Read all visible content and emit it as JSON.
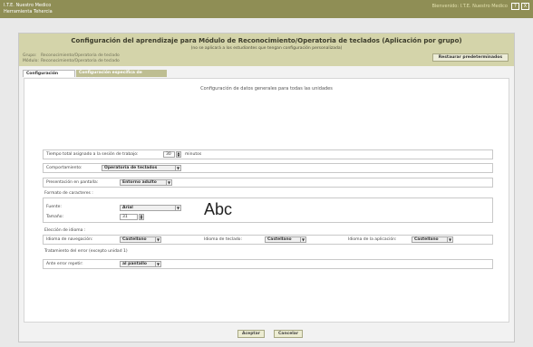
{
  "window": {
    "app_title": "I.T.E. Nuestro Medico",
    "app_subtitle": "Herramienta Tehercia",
    "user": "Bienvenido: I.T.E. Nuestro Medico",
    "help_label": "?",
    "close_label": "X"
  },
  "dialog": {
    "title": "Configuración del aprendizaje para Módulo de Reconocimiento/Operatoria de teclados (Aplicación por grupo)",
    "subtitle": "(no se aplicará a los estudiantes que tengan configuración personalizada)",
    "group_label": "Grupo:",
    "group_value": "Reconocimiento/Operatoria de teclado",
    "module_label": "Módulo:",
    "module_value": "Reconocimiento/Operatoria de teclado",
    "restore_label": "Restaurar predeterminados"
  },
  "tabs": [
    {
      "label": "Configuración general",
      "active": true
    },
    {
      "label": "Configuración específica de unidades",
      "active": false
    }
  ],
  "panel": {
    "heading": "Configuración de datos generales para todas las unidades",
    "time": {
      "label": "Tiempo total asignado a la sesión de trabajo:",
      "value": "30",
      "unit": "minutos"
    },
    "behavior": {
      "label": "Comportamiento:",
      "value": "Operatoria de teclados"
    },
    "presentation": {
      "label": "Presentación en pantalla:",
      "value": "Entorno adulto"
    },
    "char_format": {
      "section": "Formato de caracteres :",
      "font_label": "Fuente:",
      "font_value": "Arial",
      "size_label": "Tamaño:",
      "size_value": "31",
      "preview": "Abc"
    },
    "language": {
      "section": "Elección de idioma :",
      "nav_label": "Idioma de navegación:",
      "nav_value": "Castellano",
      "kbd_label": "Idioma de teclado:",
      "kbd_value": "Castellano",
      "app_label": "Idioma de la aplicación:",
      "app_value": "Castellano"
    },
    "error": {
      "section": "Tratamiento del error (excepto unidad 1)",
      "label": "Ante error repetir:",
      "value": "al pantallo"
    }
  },
  "buttons": {
    "accept": "Aceptar",
    "cancel": "Cancelar"
  }
}
